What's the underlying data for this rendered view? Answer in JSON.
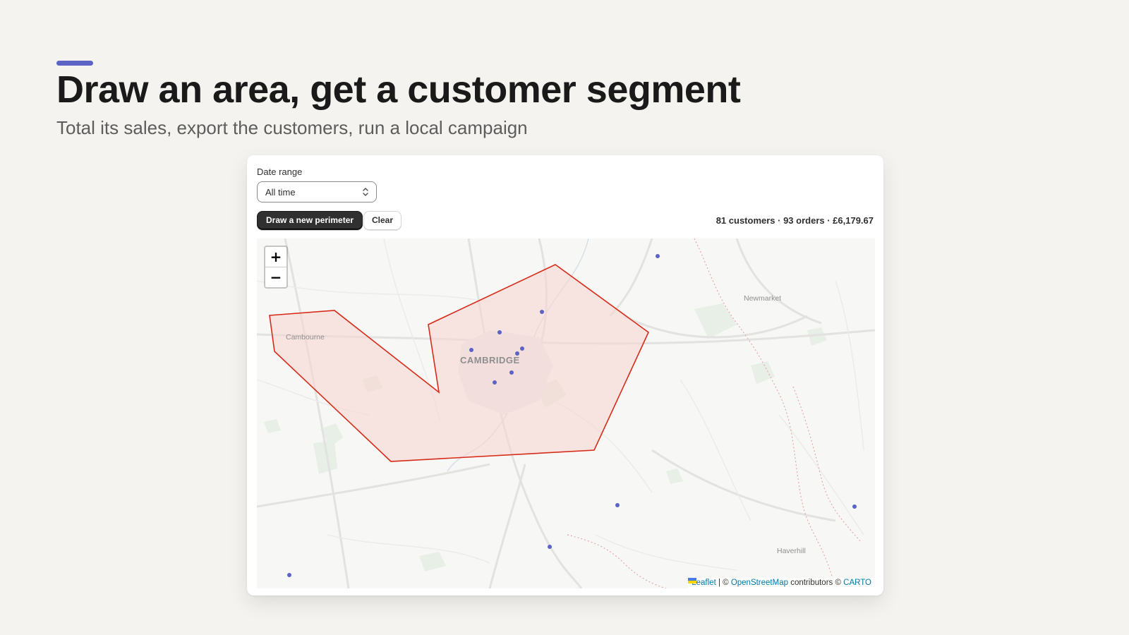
{
  "headline": "Draw an area, get a customer segment",
  "subheadline": "Total its sales, export the customers, run a local campaign",
  "colors": {
    "accent": "#5b63c4",
    "polygon_stroke": "#d62b18",
    "polygon_fill": "#f6d6d2",
    "customer_dot": "#5b63c4",
    "primary_button": "#303030"
  },
  "filters": {
    "date_range_label": "Date range",
    "date_range_value": "All time"
  },
  "toolbar": {
    "draw_label": "Draw a new perimeter",
    "clear_label": "Clear",
    "stats": "81 customers · 93 orders · £6,179.67"
  },
  "map": {
    "zoom_in": "+",
    "zoom_out": "−",
    "places": {
      "cambridge": "CAMBRIDGE",
      "cambourne": "Cambourne",
      "newmarket": "Newmarket",
      "haverhill": "Haverhill"
    },
    "attribution": {
      "leaflet": "Leaflet",
      "separator": " | © ",
      "osm": "OpenStreetMap",
      "contributors": " contributors © ",
      "carto": "CARTO"
    },
    "icons": [
      "zoom-in-icon",
      "zoom-out-icon",
      "chevron-updown-icon",
      "ukraine-flag-icon"
    ]
  }
}
